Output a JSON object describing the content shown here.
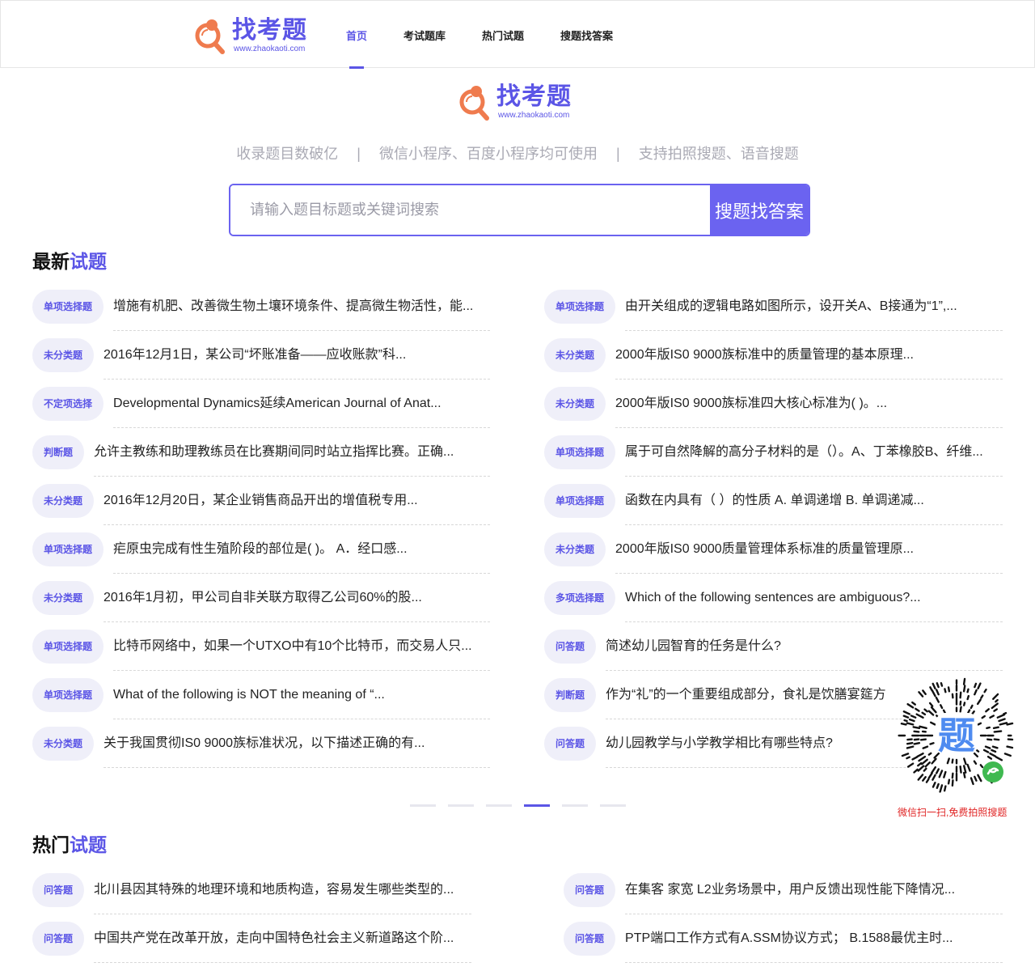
{
  "brand": {
    "name": "找考题",
    "url": "www.zhaokaoti.com",
    "accent": "#5b55e6",
    "logo_orange": "#ef7b4e"
  },
  "nav": [
    {
      "label": "首页",
      "active": true
    },
    {
      "label": "考试题库",
      "active": false
    },
    {
      "label": "热门试题",
      "active": false
    },
    {
      "label": "搜题找答案",
      "active": false
    }
  ],
  "features": [
    "收录题目数破亿",
    "微信小程序、百度小程序均可使用",
    "支持拍照搜题、语音搜题"
  ],
  "feature_sep": "|",
  "search": {
    "placeholder": "请输入题目标题或关键词搜索",
    "button": "搜题找答案"
  },
  "latest": {
    "title_a": "最新",
    "title_b": "试题",
    "left": [
      {
        "tag": "单项选择题",
        "text": "增施有机肥、改善微生物土壤环境条件、提高微生物活性，能..."
      },
      {
        "tag": "未分类题",
        "text": "2016年12月1日，某公司“坏账准备——应收账款”科..."
      },
      {
        "tag": "不定项选择",
        "text": "Developmental Dynamics延续American Journal of Anat..."
      },
      {
        "tag": "判断题",
        "text": "允许主教练和助理教练员在比赛期间同时站立指挥比赛。正确..."
      },
      {
        "tag": "未分类题",
        "text": "2016年12月20日，某企业销售商品开出的增值税专用..."
      },
      {
        "tag": "单项选择题",
        "text": "疟原虫完成有性生殖阶段的部位是( )。 A．经口感..."
      },
      {
        "tag": "未分类题",
        "text": "2016年1月初，甲公司自非关联方取得乙公司60%的股..."
      },
      {
        "tag": "单项选择题",
        "text": "比特币网络中，如果一个UTXO中有10个比特币，而交易人只..."
      },
      {
        "tag": "单项选择题",
        "text": "What of the following is NOT the meaning of “..."
      },
      {
        "tag": "未分类题",
        "text": "关于我国贯彻IS0 9000族标准状况，以下描述正确的有..."
      }
    ],
    "right": [
      {
        "tag": "单项选择题",
        "text": "由开关组成的逻辑电路如图所示，设开关A、B接通为“1”,..."
      },
      {
        "tag": "未分类题",
        "text": "2000年版IS0 9000族标准中的质量管理的基本原理..."
      },
      {
        "tag": "未分类题",
        "text": "2000年版IS0 9000族标准四大核心标准为( )。..."
      },
      {
        "tag": "单项选择题",
        "text": "属于可自然降解的高分子材料的是（）。A、丁苯橡胶B、纤维..."
      },
      {
        "tag": "单项选择题",
        "text": "函数在内具有（ ）的性质 A. 单调递增 B. 单调递减..."
      },
      {
        "tag": "未分类题",
        "text": "2000年版IS0 9000质量管理体系标准的质量管理原..."
      },
      {
        "tag": "多项选择题",
        "text": "Which of the following sentences are ambiguous?..."
      },
      {
        "tag": "问答题",
        "text": "简述幼儿园智育的任务是什么?"
      },
      {
        "tag": "判断题",
        "text": "作为“礼”的一个重要组成部分，食礼是饮膳宴筵方"
      },
      {
        "tag": "问答题",
        "text": "幼儿园教学与小学教学相比有哪些特点?"
      }
    ]
  },
  "pager": {
    "count": 6,
    "active_index": 3
  },
  "qr": {
    "caption": "微信扫一扫,免费拍照搜题",
    "glyph": "题"
  },
  "hot": {
    "title_a": "热门",
    "title_b": "试题",
    "left": [
      {
        "tag": "问答题",
        "text": "北川县因其特殊的地理环境和地质构造，容易发生哪些类型的..."
      },
      {
        "tag": "问答题",
        "text": "中国共产党在改革开放，走向中国特色社会主义新道路这个阶..."
      }
    ],
    "right": [
      {
        "tag": "问答题",
        "text": "在集客 家宽 L2业务场景中，用户反馈出现性能下降情况..."
      },
      {
        "tag": "问答题",
        "text": "PTP端口工作方式有A.SSM协议方式； B.1588最优主时..."
      }
    ]
  }
}
